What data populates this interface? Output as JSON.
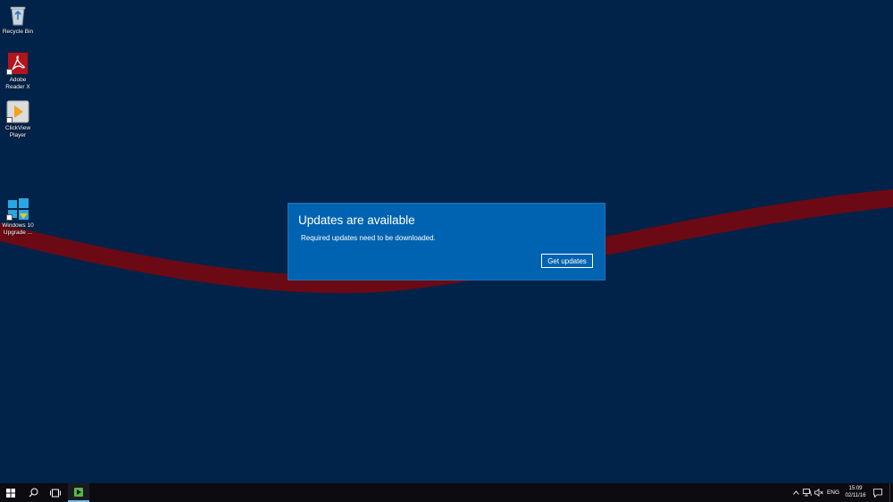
{
  "desktop": {
    "icons": [
      {
        "label": "Recycle Bin",
        "icon": "recycle-bin-icon"
      },
      {
        "label": "Adobe Reader X",
        "icon": "adobe-reader-icon"
      },
      {
        "label": "ClickView Player",
        "icon": "clickview-icon"
      },
      {
        "label": "Windows 10 Upgrade ...",
        "icon": "windows-upgrade-icon"
      }
    ]
  },
  "dialog": {
    "title": "Updates are available",
    "message": "Required updates need to be downloaded.",
    "button_label": "Get updates"
  },
  "taskbar": {
    "start_icon": "windows-start-icon",
    "search_icon": "search-icon",
    "task_view_icon": "task-view-icon",
    "pinned_app_icon": "clickview-taskbar-icon",
    "tray": {
      "chevron_icon": "chevron-up-icon",
      "network_icon": "network-icon",
      "volume_icon": "volume-muted-icon",
      "language": "ENG",
      "time": "15:09",
      "date": "02/11/16",
      "notification_icon": "action-center-icon"
    }
  },
  "colors": {
    "desktop_background": "#012349",
    "swoosh": "#6b0a14",
    "dialog_background": "#0063b1",
    "taskbar": "#0b0b10"
  }
}
